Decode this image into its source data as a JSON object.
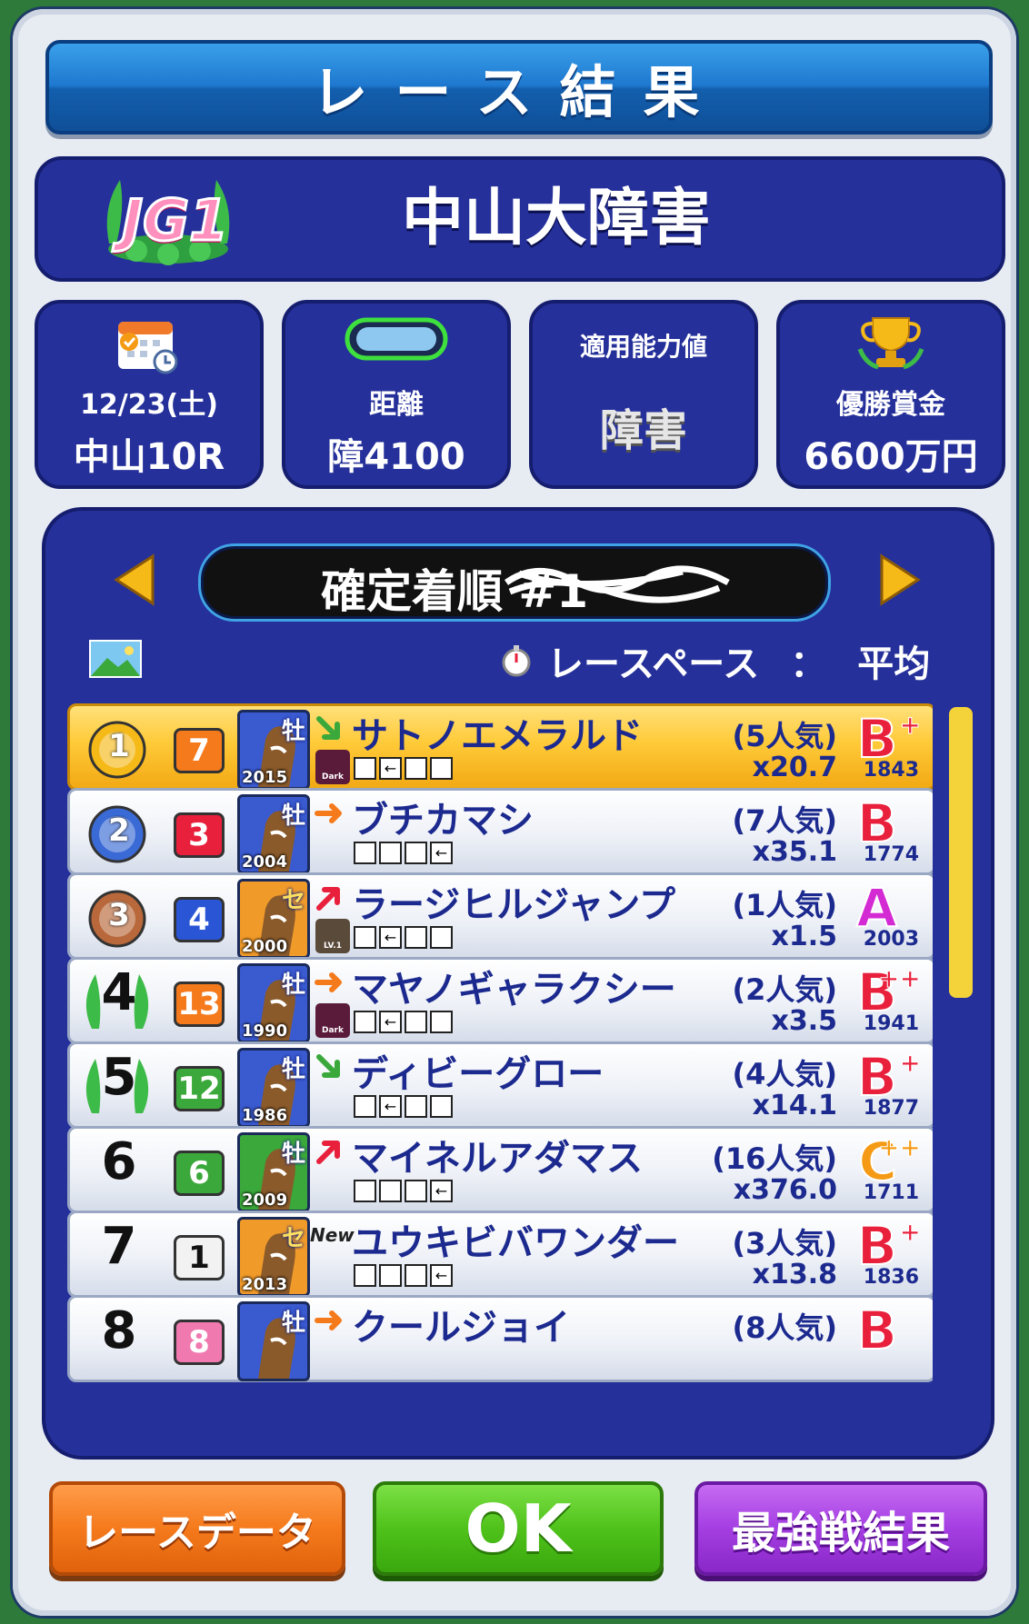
{
  "title": "レース結果",
  "race": {
    "grade": "JG1",
    "name": "中山大障害"
  },
  "info": {
    "date": "12/23(土)",
    "venue_race": "中山10R",
    "distance_label": "距離",
    "distance": "障4100",
    "ability_label": "適用能力値",
    "ability_value": "障害",
    "prize_label": "優勝賞金",
    "prize": "6600万円"
  },
  "results": {
    "header": "確定着順 #1",
    "pace_label": "レースペース",
    "pace_sep": "：",
    "pace_value": "平均",
    "rows": [
      {
        "rank": "1",
        "gate": "7",
        "sex": "牡",
        "year": "2015",
        "trend": "down",
        "name": "サトノエメラルド",
        "skill": "Dark",
        "boxes": [
          "",
          "←",
          "",
          ""
        ],
        "popularity": "(5人気)",
        "odds": "x20.7",
        "grade": "B",
        "plus": "+",
        "rating": "1843"
      },
      {
        "rank": "2",
        "gate": "3",
        "sex": "牡",
        "year": "2004",
        "trend": "flat",
        "name": "ブチカマシ",
        "skill": "",
        "boxes": [
          "",
          "",
          "",
          "←"
        ],
        "popularity": "(7人気)",
        "odds": "x35.1",
        "grade": "B",
        "plus": "",
        "rating": "1774"
      },
      {
        "rank": "3",
        "gate": "4",
        "sex": "セ",
        "year": "2000",
        "trend": "up",
        "name": "ラージヒルジャンプ",
        "skill": "LV.1",
        "boxes": [
          "",
          "←",
          "",
          ""
        ],
        "popularity": "(1人気)",
        "odds": "x1.5",
        "grade": "A",
        "plus": "",
        "rating": "2003"
      },
      {
        "rank": "4",
        "gate": "13",
        "sex": "牡",
        "year": "1990",
        "trend": "flat",
        "name": "マヤノギャラクシー",
        "skill": "Dark",
        "boxes": [
          "",
          "←",
          "",
          ""
        ],
        "popularity": "(2人気)",
        "odds": "x3.5",
        "grade": "B",
        "plus": "++",
        "rating": "1941"
      },
      {
        "rank": "5",
        "gate": "12",
        "sex": "牡",
        "year": "1986",
        "trend": "down",
        "name": "ディビーグロー",
        "skill": "",
        "boxes": [
          "",
          "←",
          "",
          ""
        ],
        "popularity": "(4人気)",
        "odds": "x14.1",
        "grade": "B",
        "plus": "+",
        "rating": "1877"
      },
      {
        "rank": "6",
        "gate": "6",
        "sex": "牡",
        "year": "2009",
        "trend": "up",
        "name": "マイネルアダマス",
        "skill": "",
        "boxes": [
          "",
          "",
          "",
          "←"
        ],
        "popularity": "(16人気)",
        "odds": "x376.0",
        "grade": "C",
        "plus": "++",
        "rating": "1711"
      },
      {
        "rank": "7",
        "gate": "1",
        "sex": "セ",
        "year": "2013",
        "trend": "new",
        "new_label": "New",
        "name": "ユウキビバワンダー",
        "skill": "",
        "boxes": [
          "",
          "",
          "",
          "←"
        ],
        "popularity": "(3人気)",
        "odds": "x13.8",
        "grade": "B",
        "plus": "+",
        "rating": "1836"
      },
      {
        "rank": "8",
        "gate": "8",
        "sex": "牡",
        "year": "",
        "trend": "flat",
        "name": "クールジョイ",
        "skill": "",
        "boxes": [],
        "popularity": "(8人気)",
        "odds": "",
        "grade": "B",
        "plus": "",
        "rating": ""
      }
    ]
  },
  "buttons": {
    "race_data": "レースデータ",
    "ok": "OK",
    "strongest": "最強戦結果"
  },
  "colors": {
    "panel": "#25309a",
    "title_blue": "#1e78cf",
    "gold_row": "#ffca38",
    "grade_b": "#e8203c",
    "grade_a": "#d42ad4",
    "grade_c": "#f59a14"
  }
}
